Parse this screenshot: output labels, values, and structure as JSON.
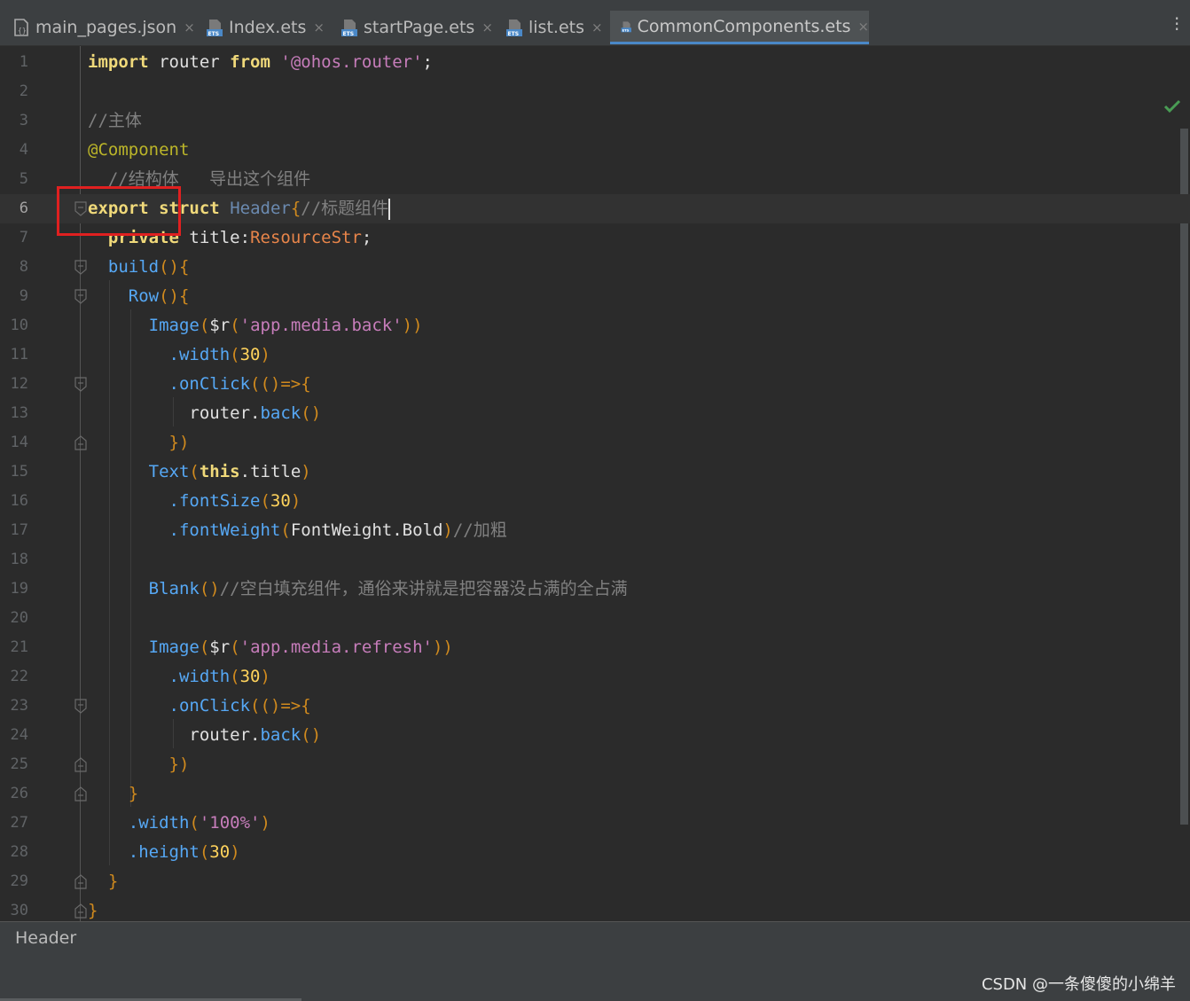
{
  "tabs": [
    {
      "label": "main_pages.json",
      "icon": "json-file-icon",
      "active": false
    },
    {
      "label": "Index.ets",
      "icon": "ets-file-icon",
      "active": false
    },
    {
      "label": "startPage.ets",
      "icon": "ets-file-icon",
      "active": false
    },
    {
      "label": "list.ets",
      "icon": "ets-file-icon",
      "active": false
    },
    {
      "label": "CommonComponents.ets",
      "icon": "ets-file-icon",
      "active": true
    }
  ],
  "close_glyph": "×",
  "menu_icon": "more-vertical-icon",
  "inspection_icon": "check-icon",
  "inspection_color": "#499c54",
  "highlight_color": "#e02020",
  "line_numbers": [
    "1",
    "2",
    "3",
    "4",
    "5",
    "6",
    "7",
    "8",
    "9",
    "10",
    "11",
    "12",
    "13",
    "14",
    "15",
    "16",
    "17",
    "18",
    "19",
    "20",
    "21",
    "22",
    "23",
    "24",
    "25",
    "26",
    "27",
    "28",
    "29",
    "30"
  ],
  "code": {
    "l1": {
      "kw1": "import",
      "t1": " router ",
      "kw2": "from",
      "sp": " ",
      "str": "'@ohos.router'",
      "semi": ";"
    },
    "l3": {
      "cmt": "//主体"
    },
    "l4": {
      "ann": "@Component"
    },
    "l5": {
      "cmt": "  //结构体   导出这个组件"
    },
    "l6": {
      "kw1": "export",
      "sp": " ",
      "kw2": "struct",
      "sp2": " ",
      "name": "Header",
      "brace": "{",
      "cmt": "//标题组件"
    },
    "l7": {
      "indent": "  ",
      "kw": "private",
      "t1": " title",
      "colon": ":",
      "ty": "ResourceStr",
      "semi": ";"
    },
    "l8": {
      "indent": "  ",
      "fn": "build",
      "p": "()",
      "b": "{"
    },
    "l9": {
      "indent": "    ",
      "fn": "Row",
      "p": "()",
      "b": "{"
    },
    "l10": {
      "indent": "      ",
      "fn": "Image",
      "p1": "(",
      "t": "$r",
      "p2": "(",
      "str": "'app.media.back'",
      "p3": "))"
    },
    "l11": {
      "indent": "        ",
      "fn": ".width",
      "p1": "(",
      "num": "30",
      "p2": ")"
    },
    "l12": {
      "indent": "        ",
      "fn": ".onClick",
      "p1": "(()=>",
      "b": "{"
    },
    "l13": {
      "indent": "          ",
      "t": "router",
      "dot": ".",
      "fn": "back",
      "p": "()"
    },
    "l14": {
      "indent": "        ",
      "b": "})"
    },
    "l15": {
      "indent": "      ",
      "fn": "Text",
      "p1": "(",
      "kw": "this",
      "t": ".title",
      "p2": ")"
    },
    "l16": {
      "indent": "        ",
      "fn": ".fontSize",
      "p1": "(",
      "num": "30",
      "p2": ")"
    },
    "l17": {
      "indent": "        ",
      "fn": ".fontWeight",
      "p1": "(",
      "t": "FontWeight.Bold",
      "p2": ")",
      "cmt": "//加粗"
    },
    "l19": {
      "indent": "      ",
      "fn": "Blank",
      "p": "()",
      "cmt": "//空白填充组件，通俗来讲就是把容器没占满的全占满"
    },
    "l21": {
      "indent": "      ",
      "fn": "Image",
      "p1": "(",
      "t": "$r",
      "p2": "(",
      "str": "'app.media.refresh'",
      "p3": "))"
    },
    "l22": {
      "indent": "        ",
      "fn": ".width",
      "p1": "(",
      "num": "30",
      "p2": ")"
    },
    "l23": {
      "indent": "        ",
      "fn": ".onClick",
      "p1": "(()=>",
      "b": "{"
    },
    "l24": {
      "indent": "          ",
      "t": "router",
      "dot": ".",
      "fn": "back",
      "p": "()"
    },
    "l25": {
      "indent": "        ",
      "b": "})"
    },
    "l26": {
      "indent": "    ",
      "b": "}"
    },
    "l27": {
      "indent": "    ",
      "fn": ".width",
      "p1": "(",
      "str": "'100%'",
      "p2": ")"
    },
    "l28": {
      "indent": "    ",
      "fn": ".height",
      "p1": "(",
      "num": "30",
      "p2": ")"
    },
    "l29": {
      "indent": "  ",
      "b": "}"
    },
    "l30": {
      "b": "}"
    }
  },
  "breadcrumb": "Header",
  "watermark": "CSDN @一条傻傻的小绵羊"
}
